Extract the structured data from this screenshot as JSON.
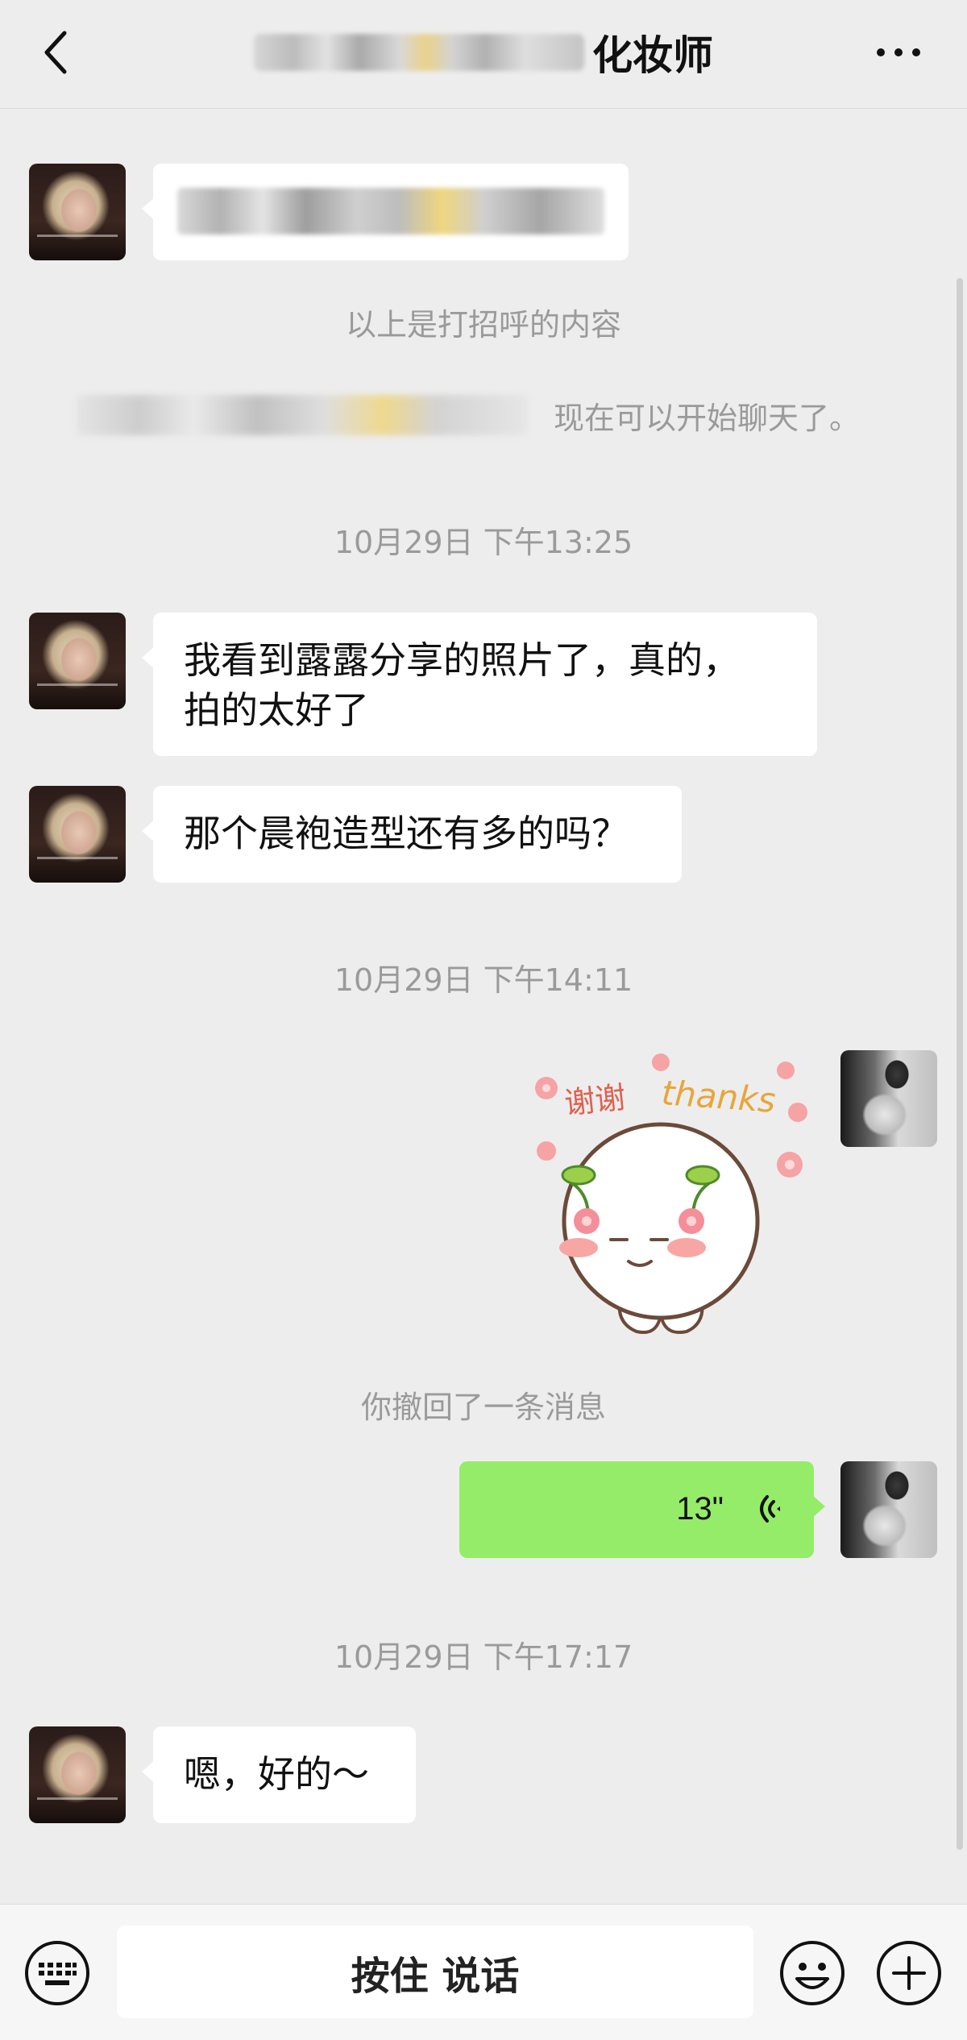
{
  "header": {
    "title_suffix": "化妆师",
    "back_icon": "chevron-left-icon",
    "more_icon": "more-icon"
  },
  "system": {
    "greeting_note": "以上是打招呼的内容",
    "can_chat_now": "现在可以开始聊天了。",
    "recall_note": "你撤回了一条消息"
  },
  "timestamps": [
    "10月29日 下午13:25",
    "10月29日 下午14:11",
    "10月29日 下午17:17"
  ],
  "messages": [
    {
      "from": "contact",
      "type": "text",
      "text": "我看到露露分享的照片了，真的，\n拍的太好了"
    },
    {
      "from": "contact",
      "type": "text",
      "text": "那个晨袍造型还有多的吗？"
    },
    {
      "from": "self",
      "type": "sticker",
      "text_cn": "谢谢",
      "text_en": "thanks"
    },
    {
      "from": "self",
      "type": "voice",
      "duration": "13\""
    },
    {
      "from": "contact",
      "type": "text",
      "text": "嗯，好的～"
    }
  ],
  "input_bar": {
    "hold_to_talk": "按住 说话",
    "keyboard_icon": "keyboard-icon",
    "emoji_icon": "emoji-icon",
    "plus_icon": "plus-icon"
  },
  "colors": {
    "background": "#ededed",
    "bubble_contact": "#ffffff",
    "bubble_self": "#95ec69",
    "system_text": "#9a9a9a"
  }
}
